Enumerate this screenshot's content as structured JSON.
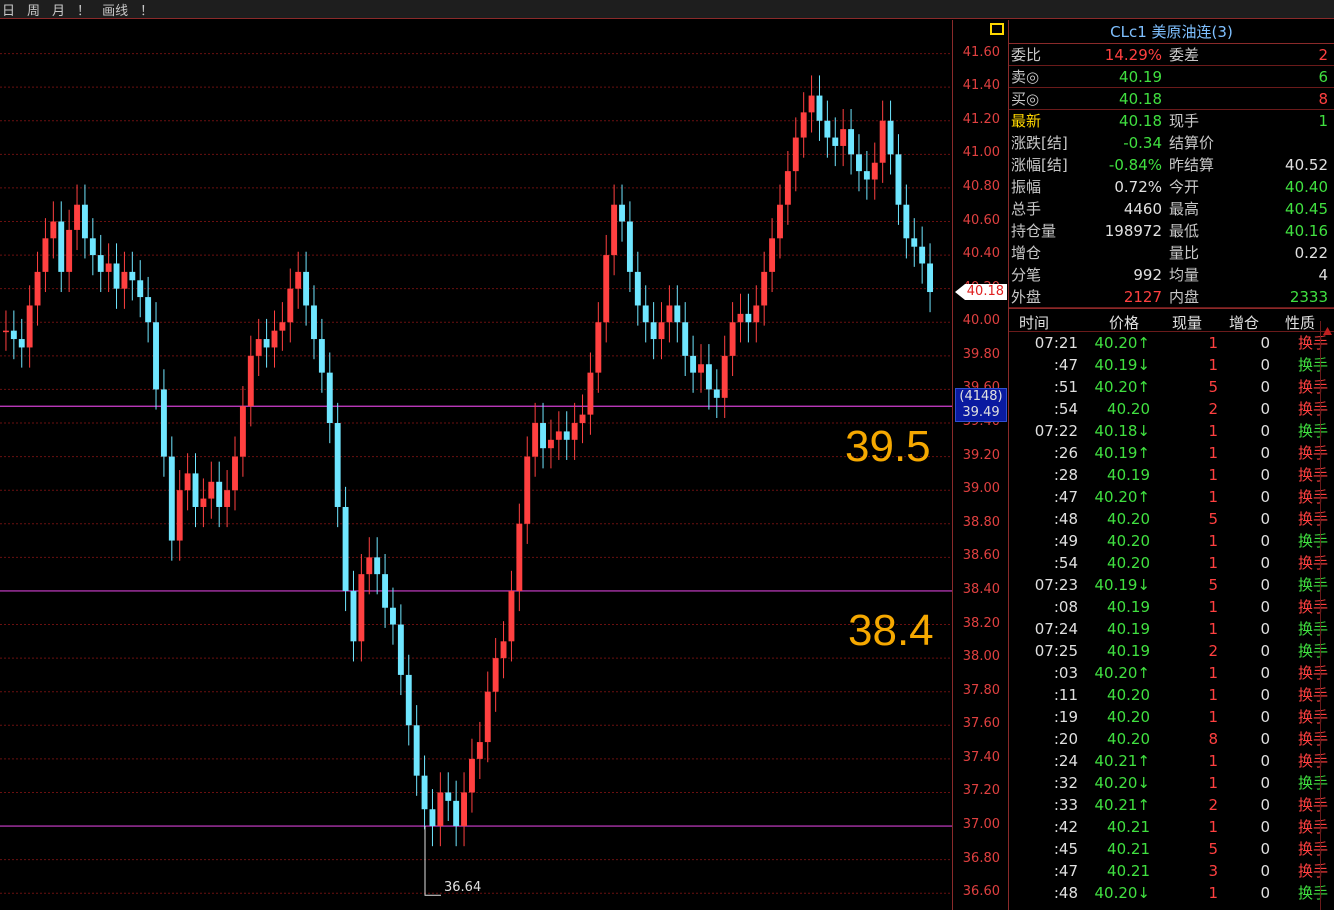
{
  "toolbar": {
    "items": [
      "日",
      "周",
      "月",
      "！",
      "画线",
      "！"
    ]
  },
  "chart": {
    "ymin": 36.5,
    "ymax": 41.8,
    "yticks": [
      "41.60",
      "41.40",
      "41.20",
      "41.00",
      "40.80",
      "40.60",
      "40.40",
      "40.20",
      "40.00",
      "39.80",
      "39.60",
      "39.40",
      "39.20",
      "39.00",
      "38.80",
      "38.60",
      "38.40",
      "38.20",
      "38.00",
      "37.80",
      "37.60",
      "37.40",
      "37.20",
      "37.00",
      "36.80",
      "36.60"
    ],
    "hlines": [
      39.5,
      38.4,
      37.0
    ],
    "zone_labels": [
      "39.5",
      "38.4"
    ],
    "low_label": "36.64",
    "last_price_tag": "40.18",
    "line_tag": {
      "count": "(4148)",
      "value": "39.49"
    },
    "candles": [
      39.95,
      39.9,
      39.85,
      40.1,
      40.3,
      40.5,
      40.6,
      40.3,
      40.55,
      40.7,
      40.5,
      40.4,
      40.3,
      40.35,
      40.2,
      40.3,
      40.25,
      40.15,
      40.0,
      39.6,
      39.2,
      38.7,
      39.0,
      39.1,
      38.9,
      38.95,
      39.05,
      38.9,
      39.0,
      39.2,
      39.5,
      39.8,
      39.9,
      39.85,
      39.95,
      40.0,
      40.2,
      40.3,
      40.1,
      39.9,
      39.7,
      39.4,
      38.9,
      38.4,
      38.1,
      38.5,
      38.6,
      38.5,
      38.3,
      38.2,
      37.9,
      37.6,
      37.3,
      37.1,
      37.0,
      37.2,
      37.15,
      37.0,
      37.2,
      37.4,
      37.5,
      37.8,
      38.0,
      38.1,
      38.4,
      38.8,
      39.2,
      39.4,
      39.25,
      39.3,
      39.35,
      39.3,
      39.4,
      39.45,
      39.7,
      40.0,
      40.4,
      40.7,
      40.6,
      40.3,
      40.1,
      40.0,
      39.9,
      40.0,
      40.1,
      40.0,
      39.8,
      39.7,
      39.75,
      39.6,
      39.55,
      39.8,
      40.0,
      40.05,
      40.0,
      40.1,
      40.3,
      40.5,
      40.7,
      40.9,
      41.1,
      41.25,
      41.35,
      41.2,
      41.1,
      41.05,
      41.15,
      41.0,
      40.9,
      40.85,
      40.95,
      41.2,
      41.0,
      40.7,
      40.5,
      40.45,
      40.35,
      40.18
    ],
    "candle_colors": [
      "#ff4040",
      "#6fe6ff"
    ]
  },
  "quote": {
    "title": "CLc1 美原油连(3)",
    "rows": [
      {
        "l1": "委比",
        "v1": "14.29%",
        "c1": "red",
        "l2": "委差",
        "v2": "2",
        "c2": "red"
      },
      {
        "l1": "卖◎",
        "v1": "40.19",
        "c1": "green",
        "l2": "",
        "v2": "6",
        "c2": "green"
      },
      {
        "l1": "买◎",
        "v1": "40.18",
        "c1": "green",
        "l2": "",
        "v2": "8",
        "c2": "red"
      },
      {
        "l1": "最新",
        "v1": "40.18",
        "c1": "green",
        "l2": "现手",
        "v2": "1",
        "c2": "green",
        "l1c": "yellow"
      },
      {
        "l1": "涨跌[结]",
        "v1": "-0.34",
        "c1": "green",
        "l2": "结算价",
        "v2": "",
        "c2": "white"
      },
      {
        "l1": "涨幅[结]",
        "v1": "-0.84%",
        "c1": "green",
        "l2": "昨结算",
        "v2": "40.52",
        "c2": "white"
      },
      {
        "l1": "振幅",
        "v1": "0.72%",
        "c1": "white",
        "l2": "今开",
        "v2": "40.40",
        "c2": "green"
      },
      {
        "l1": "总手",
        "v1": "4460",
        "c1": "white",
        "l2": "最高",
        "v2": "40.45",
        "c2": "green"
      },
      {
        "l1": "持仓量",
        "v1": "198972",
        "c1": "white",
        "l2": "最低",
        "v2": "40.16",
        "c2": "green"
      },
      {
        "l1": "增仓",
        "v1": "",
        "c1": "white",
        "l2": "量比",
        "v2": "0.22",
        "c2": "white"
      },
      {
        "l1": "分笔",
        "v1": "992",
        "c1": "white",
        "l2": "均量",
        "v2": "4",
        "c2": "white"
      },
      {
        "l1": "外盘",
        "v1": "2127",
        "c1": "red",
        "l2": "内盘",
        "v2": "2333",
        "c2": "green"
      }
    ]
  },
  "ticks": {
    "headers": [
      "时间",
      "价格",
      "现量",
      "增仓",
      "性质"
    ],
    "rows": [
      {
        "t": "07:21",
        "p": "40.20↑",
        "pc": "green",
        "v": "1",
        "o": "0",
        "n": "换手",
        "nc": "red"
      },
      {
        "t": ":47",
        "p": "40.19↓",
        "pc": "green",
        "v": "1",
        "o": "0",
        "n": "换手",
        "nc": "green"
      },
      {
        "t": ":51",
        "p": "40.20↑",
        "pc": "green",
        "v": "5",
        "o": "0",
        "n": "换手",
        "nc": "red"
      },
      {
        "t": ":54",
        "p": "40.20",
        "pc": "green",
        "v": "2",
        "o": "0",
        "n": "换手",
        "nc": "red"
      },
      {
        "t": "07:22",
        "p": "40.18↓",
        "pc": "green",
        "v": "1",
        "o": "0",
        "n": "换手",
        "nc": "green"
      },
      {
        "t": ":26",
        "p": "40.19↑",
        "pc": "green",
        "v": "1",
        "o": "0",
        "n": "换手",
        "nc": "red"
      },
      {
        "t": ":28",
        "p": "40.19",
        "pc": "green",
        "v": "1",
        "o": "0",
        "n": "换手",
        "nc": "red"
      },
      {
        "t": ":47",
        "p": "40.20↑",
        "pc": "green",
        "v": "1",
        "o": "0",
        "n": "换手",
        "nc": "red"
      },
      {
        "t": ":48",
        "p": "40.20",
        "pc": "green",
        "v": "5",
        "o": "0",
        "n": "换手",
        "nc": "red"
      },
      {
        "t": ":49",
        "p": "40.20",
        "pc": "green",
        "v": "1",
        "o": "0",
        "n": "换手",
        "nc": "green"
      },
      {
        "t": ":54",
        "p": "40.20",
        "pc": "green",
        "v": "1",
        "o": "0",
        "n": "换手",
        "nc": "red"
      },
      {
        "t": "07:23",
        "p": "40.19↓",
        "pc": "green",
        "v": "5",
        "o": "0",
        "n": "换手",
        "nc": "green"
      },
      {
        "t": ":08",
        "p": "40.19",
        "pc": "green",
        "v": "1",
        "o": "0",
        "n": "换手",
        "nc": "red"
      },
      {
        "t": "07:24",
        "p": "40.19",
        "pc": "green",
        "v": "1",
        "o": "0",
        "n": "换手",
        "nc": "green"
      },
      {
        "t": "07:25",
        "p": "40.19",
        "pc": "green",
        "v": "2",
        "o": "0",
        "n": "换手",
        "nc": "green"
      },
      {
        "t": ":03",
        "p": "40.20↑",
        "pc": "green",
        "v": "1",
        "o": "0",
        "n": "换手",
        "nc": "red"
      },
      {
        "t": ":11",
        "p": "40.20",
        "pc": "green",
        "v": "1",
        "o": "0",
        "n": "换手",
        "nc": "red"
      },
      {
        "t": ":19",
        "p": "40.20",
        "pc": "green",
        "v": "1",
        "o": "0",
        "n": "换手",
        "nc": "red"
      },
      {
        "t": ":20",
        "p": "40.20",
        "pc": "green",
        "v": "8",
        "o": "0",
        "n": "换手",
        "nc": "red"
      },
      {
        "t": ":24",
        "p": "40.21↑",
        "pc": "green",
        "v": "1",
        "o": "0",
        "n": "换手",
        "nc": "red"
      },
      {
        "t": ":32",
        "p": "40.20↓",
        "pc": "green",
        "v": "1",
        "o": "0",
        "n": "换手",
        "nc": "green"
      },
      {
        "t": ":33",
        "p": "40.21↑",
        "pc": "green",
        "v": "2",
        "o": "0",
        "n": "换手",
        "nc": "red"
      },
      {
        "t": ":42",
        "p": "40.21",
        "pc": "green",
        "v": "1",
        "o": "0",
        "n": "换手",
        "nc": "red"
      },
      {
        "t": ":45",
        "p": "40.21",
        "pc": "green",
        "v": "5",
        "o": "0",
        "n": "换手",
        "nc": "red"
      },
      {
        "t": ":47",
        "p": "40.21",
        "pc": "green",
        "v": "3",
        "o": "0",
        "n": "换手",
        "nc": "red"
      },
      {
        "t": ":48",
        "p": "40.20↓",
        "pc": "green",
        "v": "1",
        "o": "0",
        "n": "换手",
        "nc": "green"
      }
    ]
  }
}
